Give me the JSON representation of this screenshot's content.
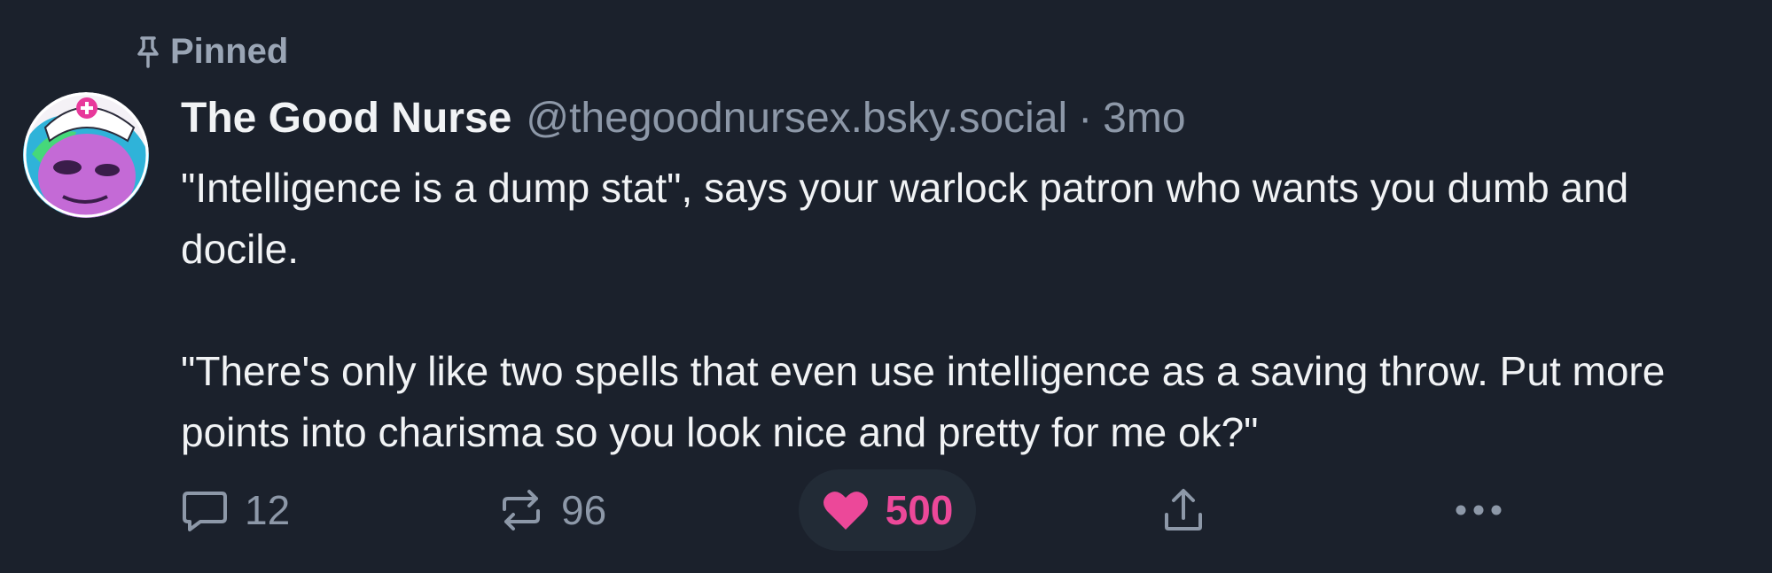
{
  "pinned": {
    "label": "Pinned"
  },
  "author": {
    "display_name": "The Good Nurse",
    "handle": "@thegoodnursex.bsky.social",
    "separator": "·",
    "time": "3mo"
  },
  "post": {
    "paragraph_1": "\"Intelligence is a dump stat\", says your warlock patron who wants you dumb and docile.",
    "paragraph_2": "\"There's only like two spells that even use intelligence as a saving throw. Put more points into charisma so you look nice and pretty for me ok?\""
  },
  "actions": {
    "reply_count": "12",
    "repost_count": "96",
    "like_count": "500",
    "liked": true
  },
  "icons": {
    "pin": "pin-icon",
    "reply": "speech-bubble-icon",
    "repost": "repost-arrows-icon",
    "like": "heart-icon",
    "share": "share-upload-icon",
    "more": "ellipsis-icon"
  },
  "colors": {
    "background": "#1b212c",
    "like_accent": "#ec4899",
    "muted_text": "#8d98a8"
  }
}
